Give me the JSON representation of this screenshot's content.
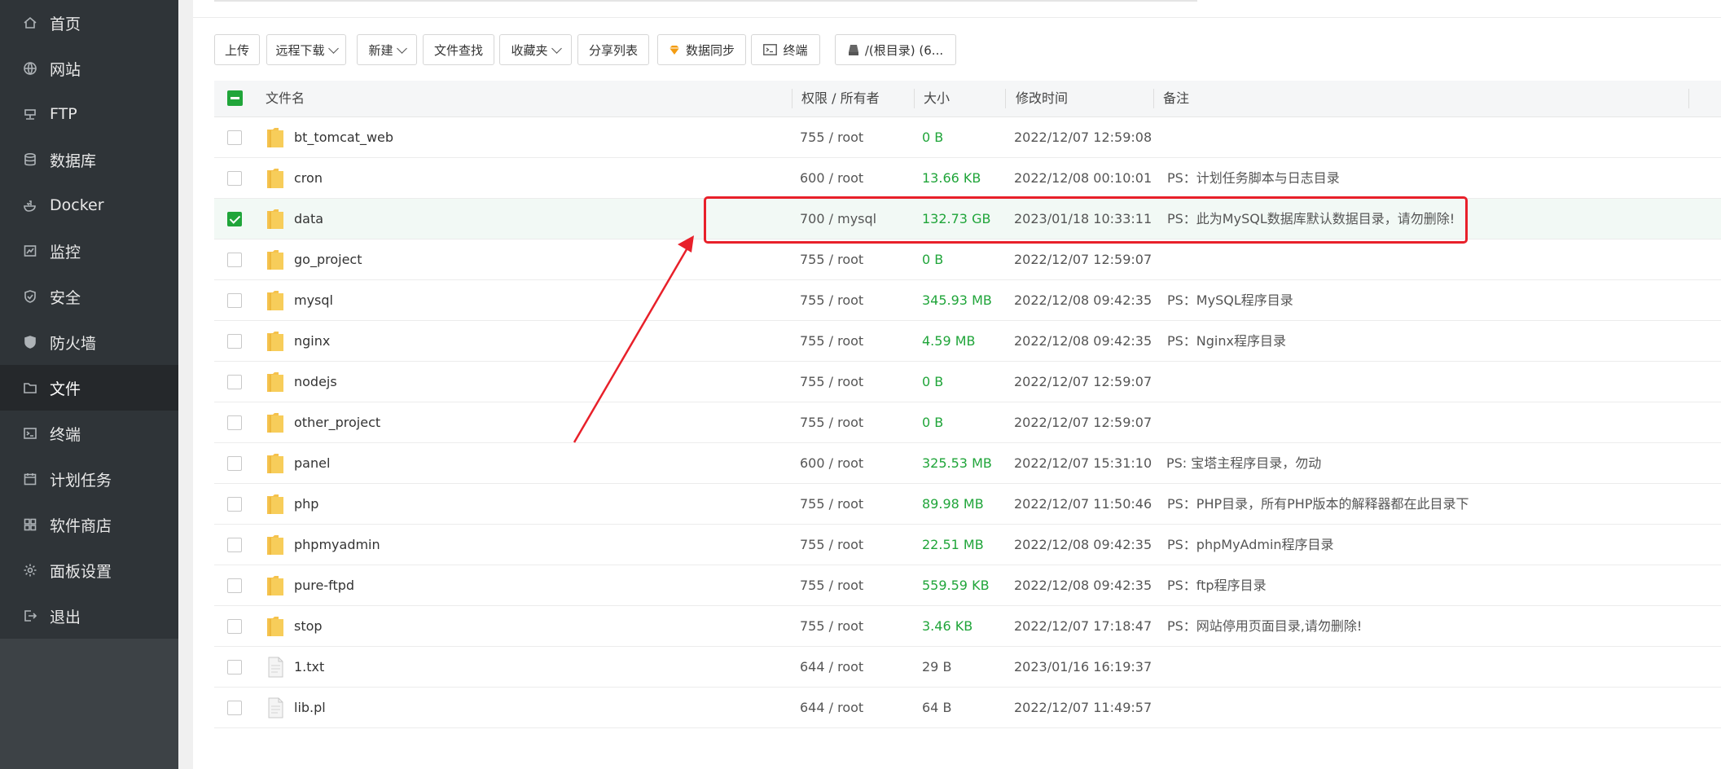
{
  "sidebar": {
    "items": [
      {
        "label": "首页",
        "icon": "home-icon"
      },
      {
        "label": "网站",
        "icon": "globe-icon"
      },
      {
        "label": "FTP",
        "icon": "ftp-icon"
      },
      {
        "label": "数据库",
        "icon": "database-icon"
      },
      {
        "label": "Docker",
        "icon": "docker-icon"
      },
      {
        "label": "监控",
        "icon": "monitor-icon"
      },
      {
        "label": "安全",
        "icon": "shield-check-icon"
      },
      {
        "label": "防火墙",
        "icon": "firewall-shield-icon"
      },
      {
        "label": "文件",
        "icon": "folder-icon",
        "active": true
      },
      {
        "label": "终端",
        "icon": "terminal-icon"
      },
      {
        "label": "计划任务",
        "icon": "calendar-icon"
      },
      {
        "label": "软件商店",
        "icon": "apps-grid-icon"
      },
      {
        "label": "面板设置",
        "icon": "gear-icon"
      },
      {
        "label": "退出",
        "icon": "logout-icon"
      }
    ]
  },
  "toolbar": {
    "upload": "上传",
    "remote_download": "远程下载",
    "new": "新建",
    "file_search": "文件查找",
    "favorites": "收藏夹",
    "share_list": "分享列表",
    "data_sync": "数据同步",
    "terminal": "终端",
    "path": "/(根目录) (6..."
  },
  "table": {
    "headers": {
      "name": "文件名",
      "perm": "权限 / 所有者",
      "size": "大小",
      "mtime": "修改时间",
      "note": "备注"
    },
    "rows": [
      {
        "type": "folder",
        "name": "bt_tomcat_web",
        "perm": "755 / root",
        "size": "0 B",
        "mtime": "2022/12/07 12:59:08",
        "note": ""
      },
      {
        "type": "folder",
        "name": "cron",
        "perm": "600 / root",
        "size": "13.66 KB",
        "mtime": "2022/12/08 00:10:01",
        "note": "PS：计划任务脚本与日志目录"
      },
      {
        "type": "folder",
        "name": "data",
        "perm": "700 / mysql",
        "size": "132.73 GB",
        "mtime": "2023/01/18 10:33:11",
        "note": "PS：此为MySQL数据库默认数据目录，请勿删除!",
        "selected": true
      },
      {
        "type": "folder",
        "name": "go_project",
        "perm": "755 / root",
        "size": "0 B",
        "mtime": "2022/12/07 12:59:07",
        "note": ""
      },
      {
        "type": "folder",
        "name": "mysql",
        "perm": "755 / root",
        "size": "345.93 MB",
        "mtime": "2022/12/08 09:42:35",
        "note": "PS：MySQL程序目录"
      },
      {
        "type": "folder",
        "name": "nginx",
        "perm": "755 / root",
        "size": "4.59 MB",
        "mtime": "2022/12/08 09:42:35",
        "note": "PS：Nginx程序目录"
      },
      {
        "type": "folder",
        "name": "nodejs",
        "perm": "755 / root",
        "size": "0 B",
        "mtime": "2022/12/07 12:59:07",
        "note": ""
      },
      {
        "type": "folder",
        "name": "other_project",
        "perm": "755 / root",
        "size": "0 B",
        "mtime": "2022/12/07 12:59:07",
        "note": ""
      },
      {
        "type": "folder",
        "name": "panel",
        "perm": "600 / root",
        "size": "325.53 MB",
        "mtime": "2022/12/07 15:31:10",
        "note": "PS: 宝塔主程序目录，勿动"
      },
      {
        "type": "folder",
        "name": "php",
        "perm": "755 / root",
        "size": "89.98 MB",
        "mtime": "2022/12/07 11:50:46",
        "note": "PS：PHP目录，所有PHP版本的解释器都在此目录下"
      },
      {
        "type": "folder",
        "name": "phpmyadmin",
        "perm": "755 / root",
        "size": "22.51 MB",
        "mtime": "2022/12/08 09:42:35",
        "note": "PS：phpMyAdmin程序目录"
      },
      {
        "type": "folder",
        "name": "pure-ftpd",
        "perm": "755 / root",
        "size": "559.59 KB",
        "mtime": "2022/12/08 09:42:35",
        "note": "PS：ftp程序目录"
      },
      {
        "type": "folder",
        "name": "stop",
        "perm": "755 / root",
        "size": "3.46 KB",
        "mtime": "2022/12/07 17:18:47",
        "note": "PS：网站停用页面目录,请勿删除!"
      },
      {
        "type": "file",
        "name": "1.txt",
        "perm": "644 / root",
        "size": "29 B",
        "mtime": "2023/01/16 16:19:37",
        "note": ""
      },
      {
        "type": "file",
        "name": "lib.pl",
        "perm": "644 / root",
        "size": "64 B",
        "mtime": "2022/12/07 11:49:57",
        "note": ""
      }
    ]
  },
  "colors": {
    "accent_green": "#20a53a",
    "annotation_red": "#e8202a",
    "sidebar_bg": "#2f3438"
  }
}
